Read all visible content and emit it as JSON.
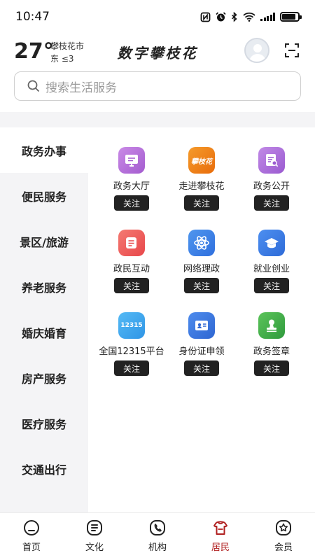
{
  "status_bar": {
    "time": "10:47",
    "icons": [
      "nfc-icon",
      "alarm-icon",
      "bluetooth-icon",
      "wifi-icon",
      "signal-icon",
      "battery-icon"
    ]
  },
  "header": {
    "temperature": "27°",
    "city": "攀枝花市",
    "wind": "东 ≤3",
    "title": "数字攀枝花"
  },
  "search": {
    "placeholder": "搜索生活服务"
  },
  "sidebar": {
    "items": [
      {
        "label": "政务办事",
        "active": true
      },
      {
        "label": "便民服务",
        "active": false
      },
      {
        "label": "景区/旅游",
        "active": false
      },
      {
        "label": "养老服务",
        "active": false
      },
      {
        "label": "婚庆婚育",
        "active": false
      },
      {
        "label": "房产服务",
        "active": false
      },
      {
        "label": "医疗服务",
        "active": false
      },
      {
        "label": "交通出行",
        "active": false
      }
    ]
  },
  "services": {
    "follow_label": "关注",
    "items": [
      {
        "name": "政务大厅",
        "icon": "hall-icon",
        "color": "#b86ad8",
        "icon_text": ""
      },
      {
        "name": "走进攀枝花",
        "icon": "panzhihua-logo-icon",
        "color": "#f07d12",
        "icon_text": "攀枝花"
      },
      {
        "name": "政务公开",
        "icon": "document-search-icon",
        "color": "#a76ad6",
        "icon_text": ""
      },
      {
        "name": "政民互动",
        "icon": "message-icon",
        "color": "#ef5a5a",
        "icon_text": ""
      },
      {
        "name": "网络理政",
        "icon": "atom-icon",
        "color": "#3f86e8",
        "icon_text": ""
      },
      {
        "name": "就业创业",
        "icon": "graduation-cap-icon",
        "color": "#3b7fe6",
        "icon_text": ""
      },
      {
        "name": "全国12315平台",
        "icon": "12315-icon",
        "color": "#3aa8f0",
        "icon_text": "12315"
      },
      {
        "name": "身份证申领",
        "icon": "id-card-icon",
        "color": "#3b7fe0",
        "icon_text": ""
      },
      {
        "name": "政务签章",
        "icon": "stamp-icon",
        "color": "#3fae4a",
        "icon_text": ""
      }
    ]
  },
  "bottom_nav": {
    "items": [
      {
        "label": "首页",
        "icon": "home-icon",
        "active": false
      },
      {
        "label": "文化",
        "icon": "culture-icon",
        "active": false
      },
      {
        "label": "机构",
        "icon": "phone-icon",
        "active": false
      },
      {
        "label": "居民",
        "icon": "resident-icon",
        "active": true
      },
      {
        "label": "会员",
        "icon": "member-star-icon",
        "active": false
      }
    ],
    "active_color": "#b02020"
  }
}
